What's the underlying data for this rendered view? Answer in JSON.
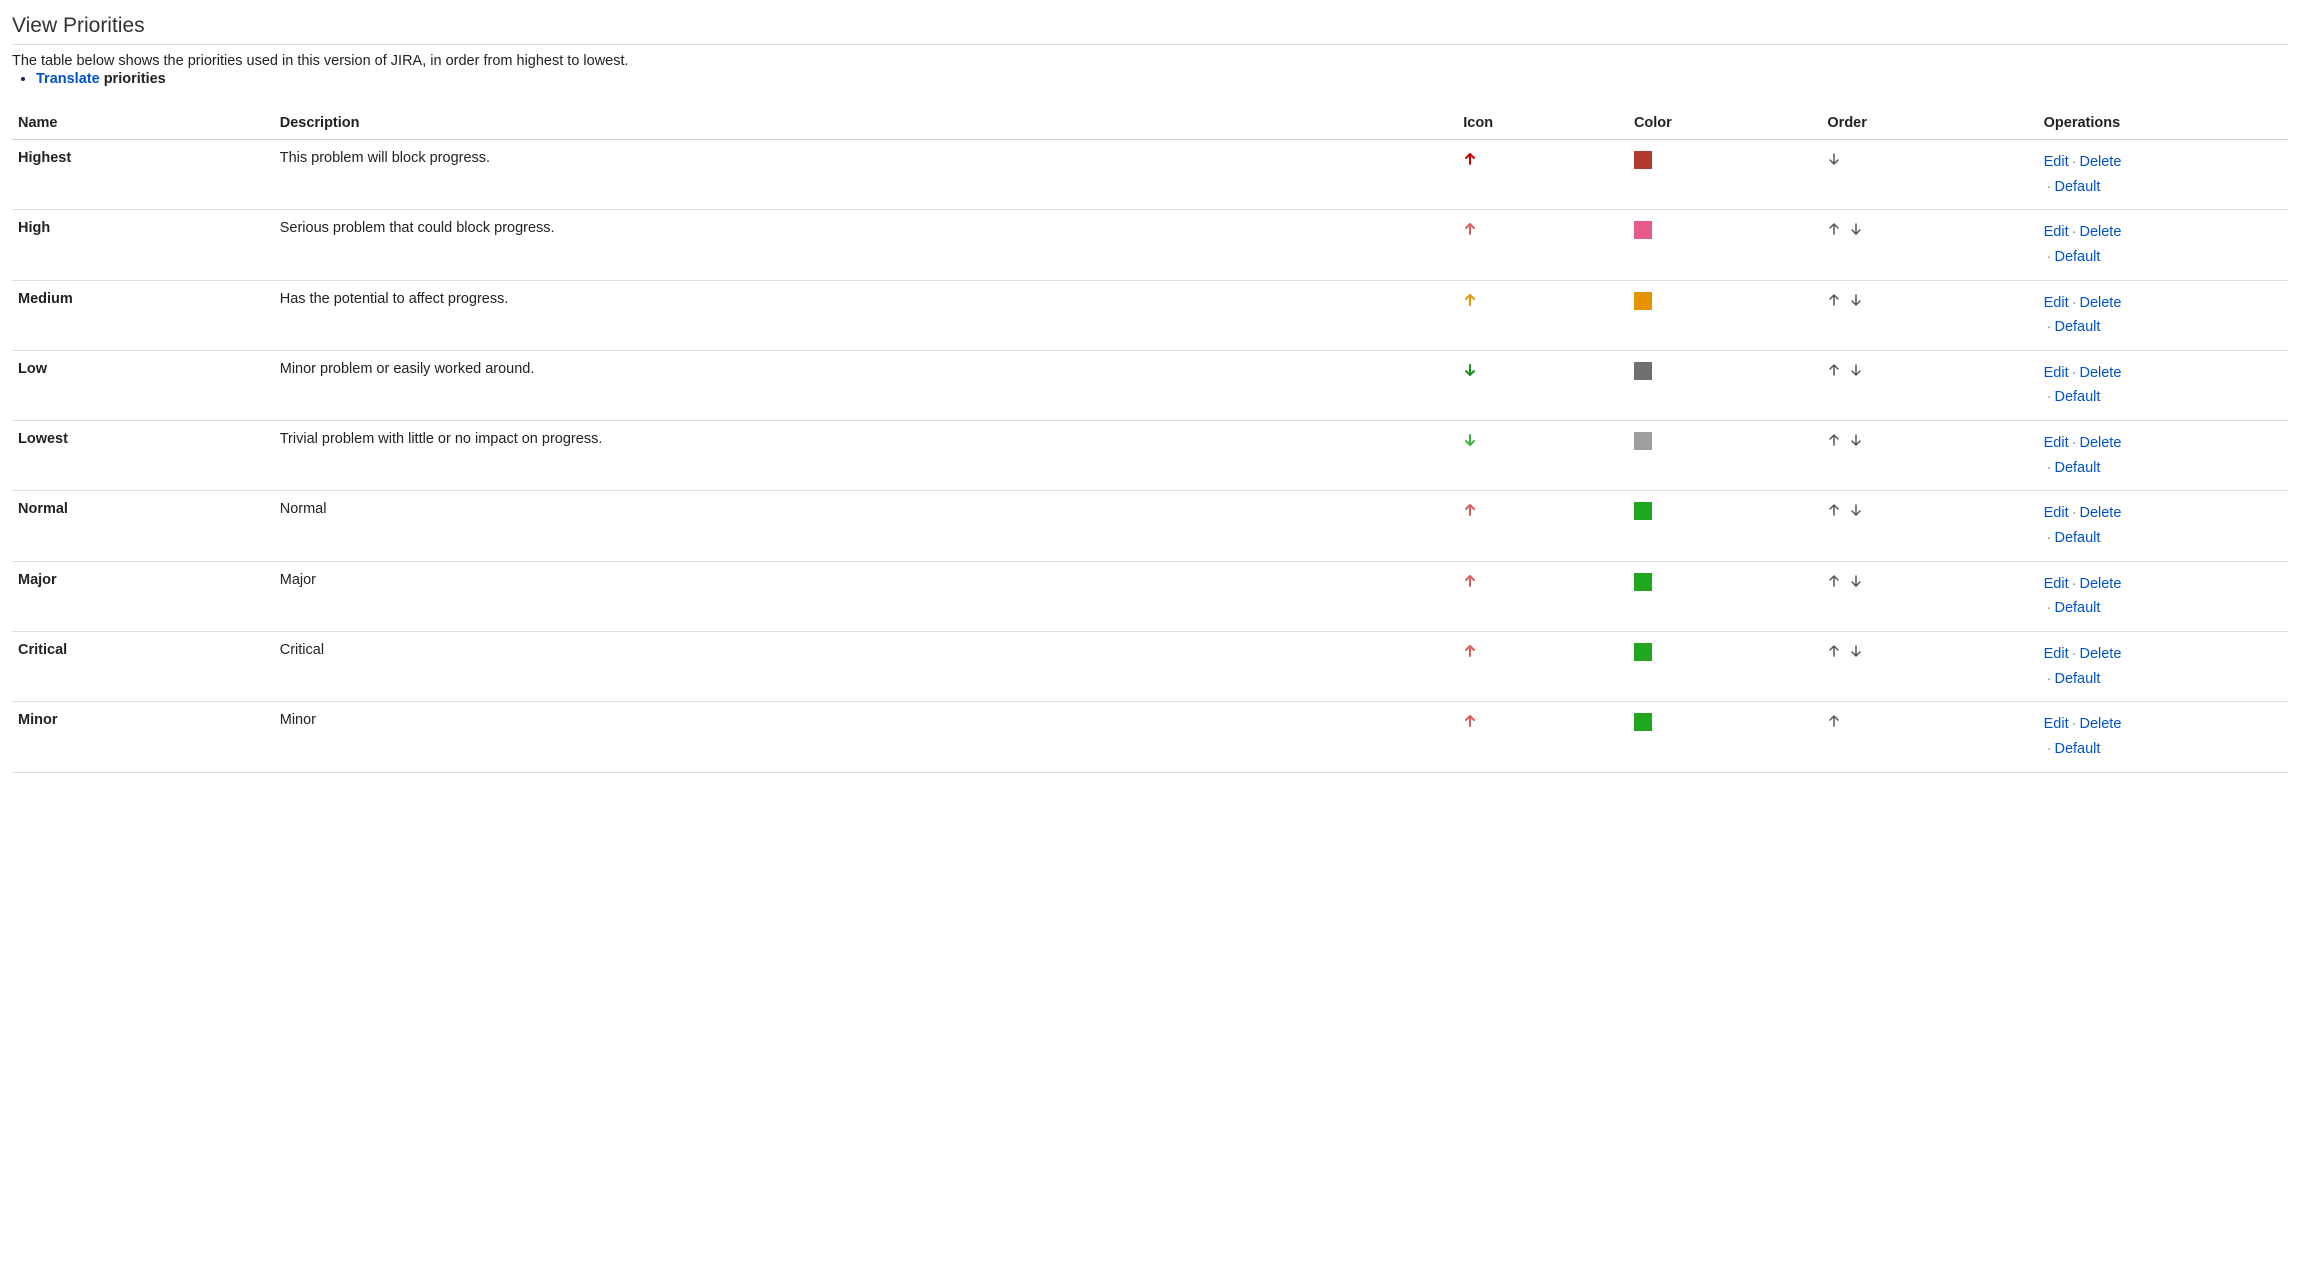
{
  "page": {
    "title": "View Priorities",
    "intro": "The table below shows the priorities used in this version of JIRA, in order from highest to lowest.",
    "translate_link": "Translate",
    "translate_suffix": "priorities"
  },
  "columns": {
    "name": "Name",
    "description": "Description",
    "icon": "Icon",
    "color": "Color",
    "order": "Order",
    "operations": "Operations"
  },
  "op_labels": {
    "edit": "Edit",
    "delete": "Delete",
    "default": "Default"
  },
  "rows": [
    {
      "name": "Highest",
      "description": "This problem will block progress.",
      "icon_dir": "up",
      "icon_color": "#cc0000",
      "swatch": "#b03a2e",
      "up": false,
      "down": true
    },
    {
      "name": "High",
      "description": "Serious problem that could block progress.",
      "icon_dir": "up",
      "icon_color": "#e05d5d",
      "swatch": "#e55c8a",
      "up": true,
      "down": true
    },
    {
      "name": "Medium",
      "description": "Has the potential to affect progress.",
      "icon_dir": "up",
      "icon_color": "#e59400",
      "swatch": "#e59400",
      "up": true,
      "down": true
    },
    {
      "name": "Low",
      "description": "Minor problem or easily worked around.",
      "icon_dir": "down",
      "icon_color": "#1a8f1a",
      "swatch": "#707070",
      "up": true,
      "down": true
    },
    {
      "name": "Lowest",
      "description": "Trivial problem with little or no impact on progress.",
      "icon_dir": "down",
      "icon_color": "#3cb43c",
      "swatch": "#9e9e9e",
      "up": true,
      "down": true
    },
    {
      "name": "Normal",
      "description": "Normal",
      "icon_dir": "up",
      "icon_color": "#e05d5d",
      "swatch": "#1fa81f",
      "up": true,
      "down": true
    },
    {
      "name": "Major",
      "description": "Major",
      "icon_dir": "up",
      "icon_color": "#e05d5d",
      "swatch": "#1fa81f",
      "up": true,
      "down": true
    },
    {
      "name": "Critical",
      "description": "Critical",
      "icon_dir": "up",
      "icon_color": "#e05d5d",
      "swatch": "#1fa81f",
      "up": true,
      "down": true
    },
    {
      "name": "Minor",
      "description": "Minor",
      "icon_dir": "up",
      "icon_color": "#e05d5d",
      "swatch": "#1fa81f",
      "up": true,
      "down": false
    }
  ]
}
